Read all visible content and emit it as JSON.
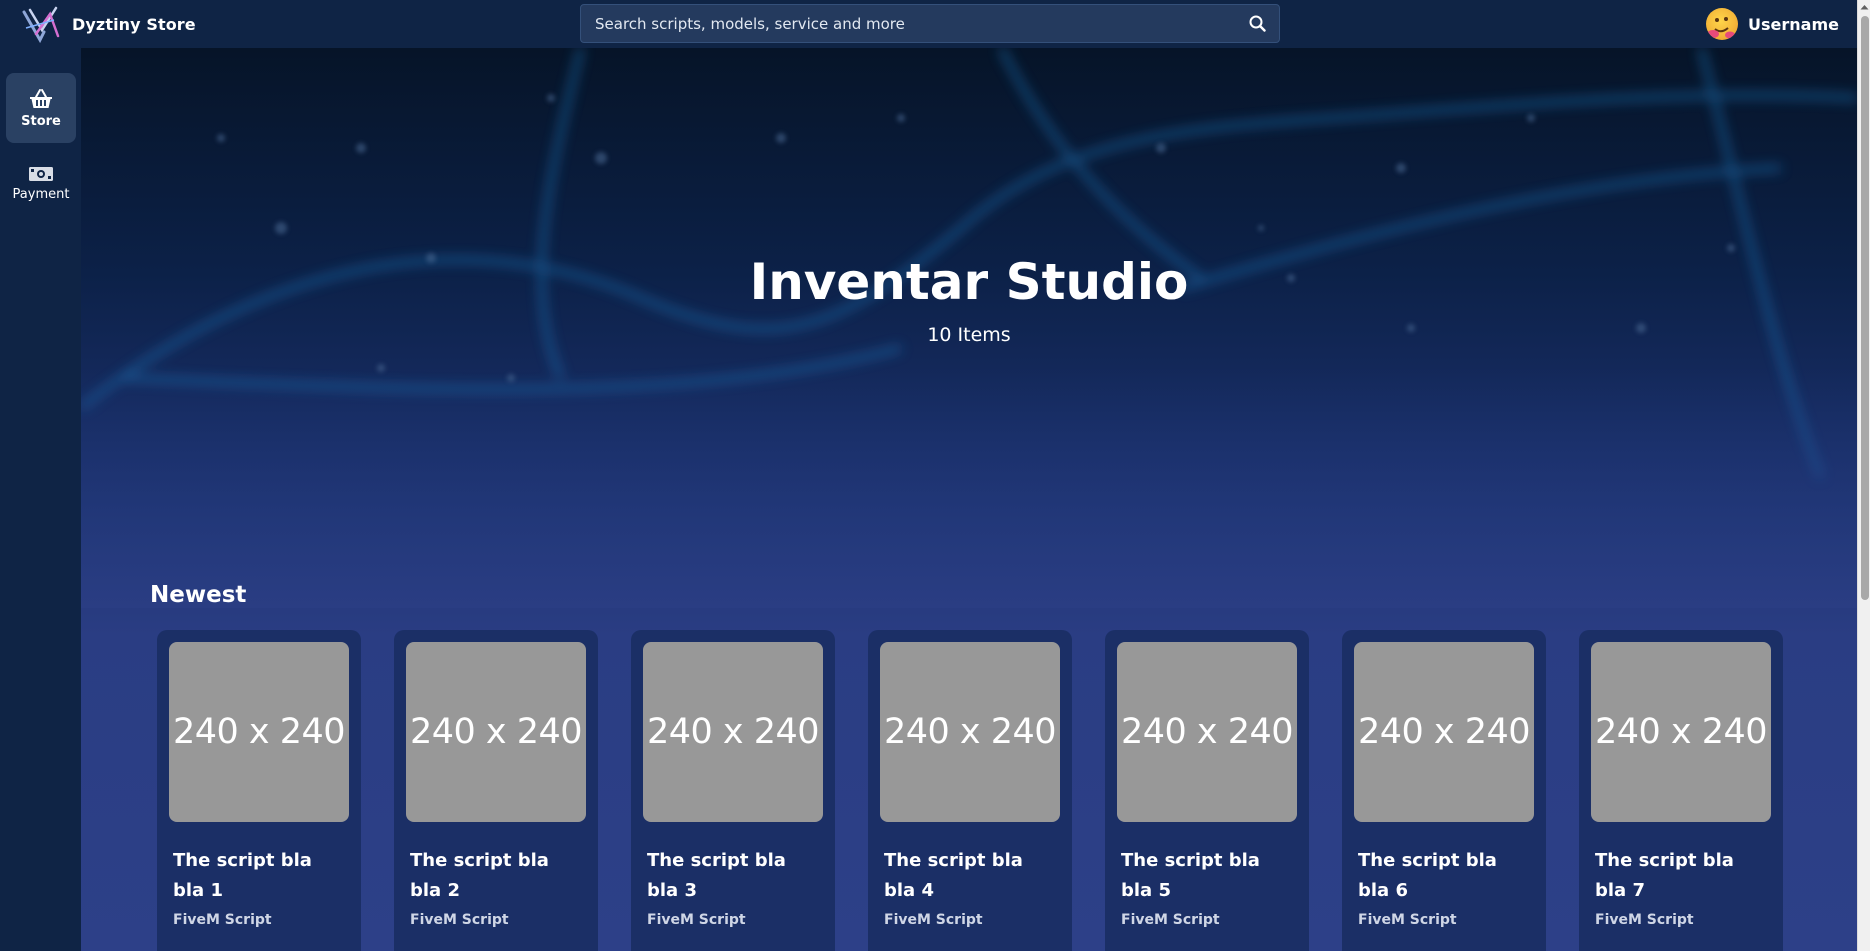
{
  "topbar": {
    "brand_name": "Dyztiny Store",
    "logo_icon": "dyztiny-logo-icon",
    "search_placeholder": "Search scripts, models, service and more",
    "search_icon": "search-icon",
    "username": "Username",
    "avatar_icon": "emoji-avatar-icon"
  },
  "sidebar": {
    "items": [
      {
        "label": "Store",
        "icon": "shopping-basket-icon",
        "active": true
      },
      {
        "label": "Payment",
        "icon": "money-bill-icon",
        "active": false
      }
    ]
  },
  "hero": {
    "title": "Inventar Studio",
    "subtitle": "10 Items"
  },
  "section": {
    "title": "Newest"
  },
  "products": [
    {
      "image_text": "240 x 240",
      "title": "The script bla bla 1",
      "category": "FiveM Script"
    },
    {
      "image_text": "240 x 240",
      "title": "The script bla bla 2",
      "category": "FiveM Script"
    },
    {
      "image_text": "240 x 240",
      "title": "The script bla bla 3",
      "category": "FiveM Script"
    },
    {
      "image_text": "240 x 240",
      "title": "The script bla bla 4",
      "category": "FiveM Script"
    },
    {
      "image_text": "240 x 240",
      "title": "The script bla bla 5",
      "category": "FiveM Script"
    },
    {
      "image_text": "240 x 240",
      "title": "The script bla bla 6",
      "category": "FiveM Script"
    },
    {
      "image_text": "240 x 240",
      "title": "The script bla bla 7",
      "category": "FiveM Script"
    }
  ],
  "colors": {
    "navbar": "#0f2445",
    "sidebar_active": "#2a4163",
    "card_bg": "#1b2f66",
    "thumb_placeholder": "#989898",
    "search_bg": "#243a5e"
  }
}
